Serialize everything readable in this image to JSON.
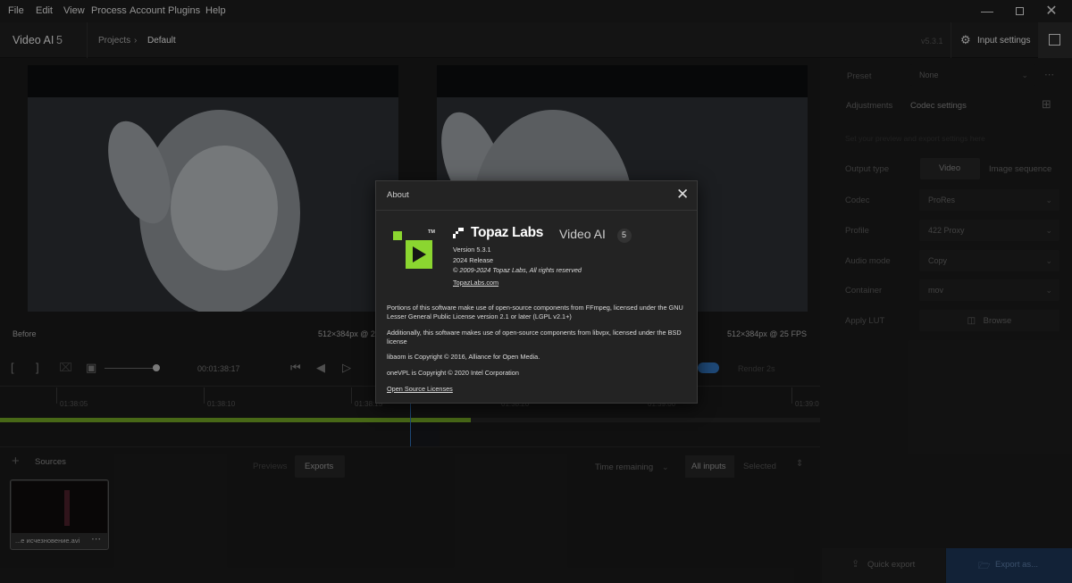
{
  "menu": [
    "File",
    "Edit",
    "View",
    "Process",
    "Account",
    "Plugins",
    "Help"
  ],
  "app": {
    "name": "Video AI",
    "version_num": "5",
    "version_label": "v5.3.1",
    "input_settings": "Input settings"
  },
  "breadcrumb": {
    "projects": "Projects",
    "current": "Default"
  },
  "preview": {
    "before_label": "Before",
    "before_res": "512×384px @ 2",
    "after_res": "512×384px @ 25 FPS",
    "timecode": "00:01:38:17",
    "render_label": "Render 2s"
  },
  "timeline": {
    "ticks": [
      "01:38:05",
      "01:38:10",
      "01:38:15",
      "01:38:20",
      "01:39:00",
      "01:39:0"
    ],
    "progress": 0.574
  },
  "sources": {
    "label": "Sources",
    "tabs": [
      "Previews",
      "Exports"
    ],
    "sort": "Time remaining",
    "filter_all": "All inputs",
    "filter_selected": "Selected",
    "item_name": "...е исчезновение.avi"
  },
  "right": {
    "preset_label": "Preset",
    "preset_value": "None",
    "tab_adjustments": "Adjustments",
    "tab_codec": "Codec settings",
    "hint": "Set your preview and export settings here",
    "output_type_label": "Output type",
    "output_video": "Video",
    "output_seq": "Image sequence",
    "codec_label": "Codec",
    "codec_value": "ProRes",
    "profile_label": "Profile",
    "profile_value": "422 Proxy",
    "audio_label": "Audio mode",
    "audio_value": "Copy",
    "container_label": "Container",
    "container_value": "mov",
    "lut_label": "Apply LUT",
    "lut_button": "Browse",
    "quick_export": "Quick export",
    "export_as": "Export as..."
  },
  "about": {
    "title": "About",
    "brand": "Topaz Labs",
    "product": "Video AI",
    "badge": "5",
    "tm": "TM",
    "version": "Version 5.3.1",
    "release": "2024 Release",
    "copyright": "© 2009-2024 Topaz Labs, All rights reserved",
    "website": "TopazLabs.com",
    "p1": "Portions of this software make use of open-source components from FFmpeg, licensed under the GNU Lesser General Public License version 2.1 or later (LGPL v2.1+)",
    "p2": "Additionally, this software makes use of open-source components from libvpx, licensed under the BSD license",
    "p3": "libaom is Copyright © 2016, Alliance for Open Media.",
    "p4": "oneVPL is Copyright © 2020 Intel Corporation",
    "oss": "Open Source Licenses",
    "logo_color": "#8bd630"
  }
}
